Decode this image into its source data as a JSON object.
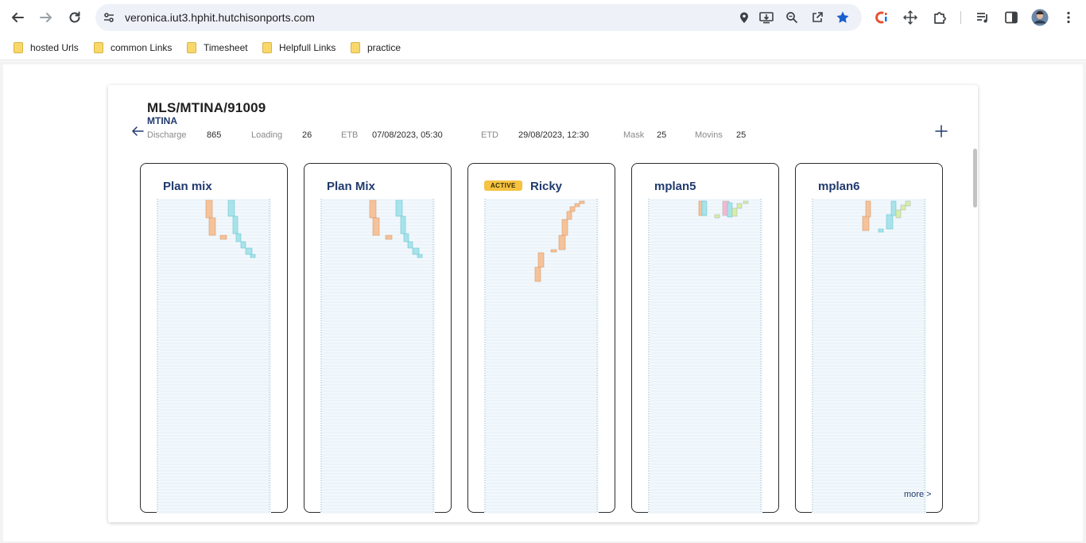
{
  "browser": {
    "url": "veronica.iut3.hphit.hutchisonports.com",
    "bookmarks": [
      {
        "label": "hosted Urls"
      },
      {
        "label": "common Links"
      },
      {
        "label": "Timesheet"
      },
      {
        "label": "Helpfull Links"
      },
      {
        "label": "practice"
      }
    ],
    "icons": {
      "back": "arrow-left-icon",
      "forward": "arrow-right-icon",
      "reload": "reload-icon",
      "site_info": "tune-icon",
      "location": "location-pin-icon",
      "install": "install-app-icon",
      "zoom": "zoom-icon",
      "share": "share-icon",
      "bookmark": "star-icon",
      "ext1": "extension-c-icon",
      "ext2": "move-icon",
      "extensions": "puzzle-icon",
      "media": "media-control-icon",
      "side_panel": "side-panel-icon",
      "profile": "avatar",
      "menu": "kebab-menu-icon"
    },
    "star_color": "#1a5fce"
  },
  "header": {
    "title": "MLS/MTINA/91009",
    "subtitle": "MTINA",
    "stats": [
      {
        "label": "Discharge",
        "value": "865"
      },
      {
        "label": "Loading",
        "value": "26"
      },
      {
        "label": "ETB",
        "value": "07/08/2023, 05:30"
      },
      {
        "label": "ETD",
        "value": "29/08/2023, 12:30"
      },
      {
        "label": "Mask",
        "value": "25"
      },
      {
        "label": "Movins",
        "value": "25"
      }
    ]
  },
  "plans": [
    {
      "name": "Plan mix",
      "active": false
    },
    {
      "name": "Plan Mix",
      "active": false
    },
    {
      "name": "Ricky",
      "active": true,
      "badge": "ACTIVE"
    },
    {
      "name": "mplan5",
      "active": false
    },
    {
      "name": "mplan6",
      "active": false
    }
  ],
  "more_link": "more >",
  "colors": {
    "accent": "#203a6e",
    "badge": "#f5c242",
    "orange": "#f5c29a",
    "cyan": "#a8e3ea",
    "green": "#d3f0a6",
    "pink": "#f2b9d1"
  }
}
